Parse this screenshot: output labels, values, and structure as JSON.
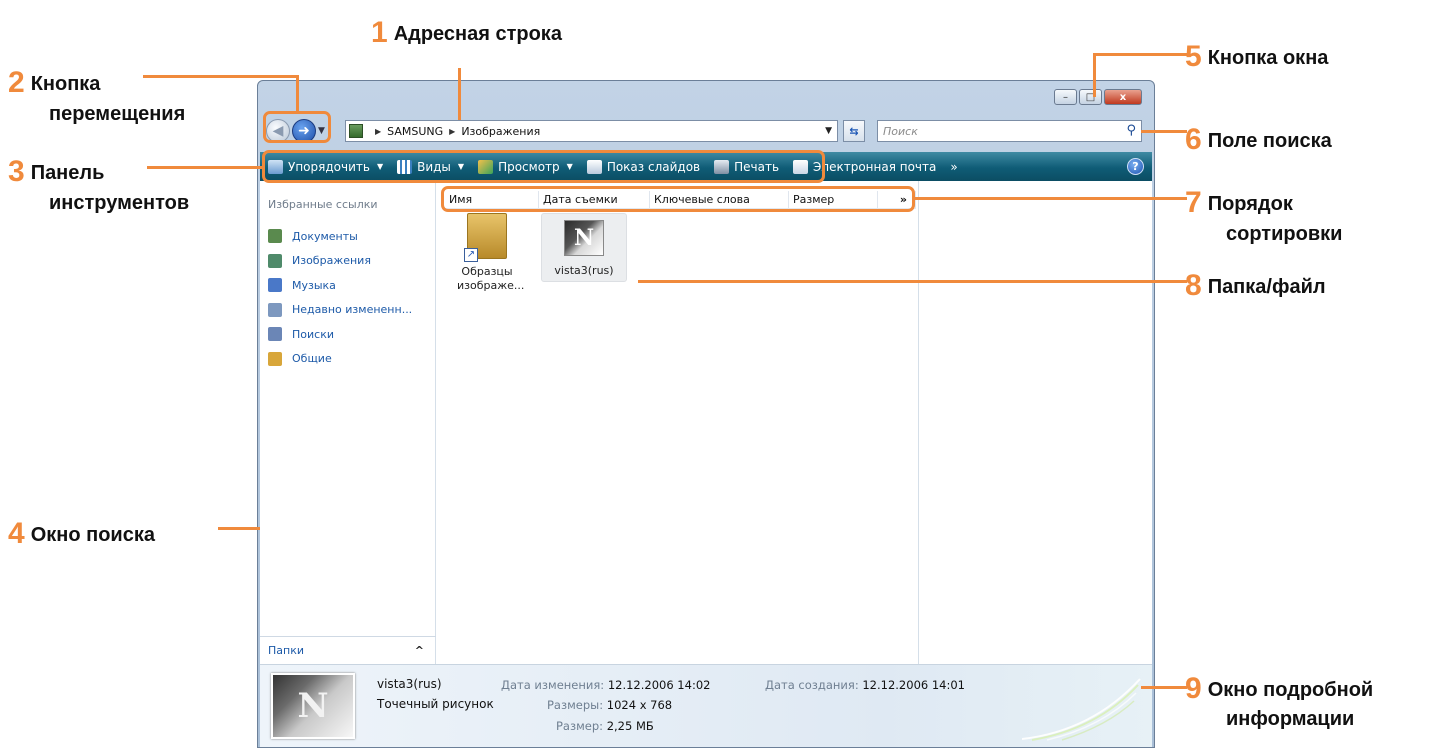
{
  "callouts": [
    {
      "num": "1",
      "text": "Адресная строка"
    },
    {
      "num": "2",
      "text_line1": "Кнопка",
      "text_line2": "перемещения"
    },
    {
      "num": "3",
      "text_line1": "Панель",
      "text_line2": "инструментов"
    },
    {
      "num": "4",
      "text": "Окно поиска"
    },
    {
      "num": "5",
      "text": "Кнопка окна"
    },
    {
      "num": "6",
      "text": "Поле поиска"
    },
    {
      "num": "7",
      "text_line1": "Порядок",
      "text_line2": "сортировки"
    },
    {
      "num": "8",
      "text": "Папка/файл"
    },
    {
      "num": "9",
      "text_line1": "Окно подробной",
      "text_line2": "информации"
    }
  ],
  "window_buttons": {
    "minimize": "–",
    "maximize": "□",
    "close": "x"
  },
  "address": {
    "root": "SAMSUNG",
    "folder": "Изображения"
  },
  "search": {
    "placeholder": "Поиск"
  },
  "toolbar": {
    "organize": "Упорядочить",
    "views": "Виды",
    "preview": "Просмотр",
    "slideshow": "Показ слайдов",
    "print": "Печать",
    "email": "Электронная почта",
    "more": "»",
    "help": "?"
  },
  "favorites": {
    "title": "Избранные ссылки",
    "items": [
      {
        "label": "Документы",
        "icon": "documents-icon",
        "color": "#5a8a4e"
      },
      {
        "label": "Изображения",
        "icon": "pictures-icon",
        "color": "#4f8a6a"
      },
      {
        "label": "Музыка",
        "icon": "music-icon",
        "color": "#4a78c8"
      },
      {
        "label": "Недавно измененн...",
        "icon": "recent-icon",
        "color": "#7d98bf"
      },
      {
        "label": "Поиски",
        "icon": "searches-icon",
        "color": "#6b86b6"
      },
      {
        "label": "Общие",
        "icon": "public-icon",
        "color": "#d8a63a"
      }
    ],
    "folders_label": "Папки"
  },
  "columns": [
    "Имя",
    "Дата съемки",
    "Ключевые слова",
    "Размер",
    "»"
  ],
  "files": [
    {
      "name_line1": "Образцы",
      "name_line2": "изображе...",
      "icon": "folder-shortcut-icon"
    },
    {
      "name": "vista3(rus)",
      "icon": "image-thumbnail-icon",
      "thumb_letter": "N"
    }
  ],
  "details": {
    "name": "vista3(rus)",
    "type": "Точечный рисунок",
    "modified_label": "Дата изменения:",
    "modified_value": "12.12.2006 14:02",
    "dimensions_label": "Размеры:",
    "dimensions_value": "1024 x 768",
    "size_label": "Размер:",
    "size_value": "2,25 МБ",
    "created_label": "Дата создания:",
    "created_value": "12.12.2006 14:01"
  },
  "colors": {
    "accent": "#f08a3c",
    "toolbar": "#0f5c76",
    "link": "#1d5aa8"
  }
}
